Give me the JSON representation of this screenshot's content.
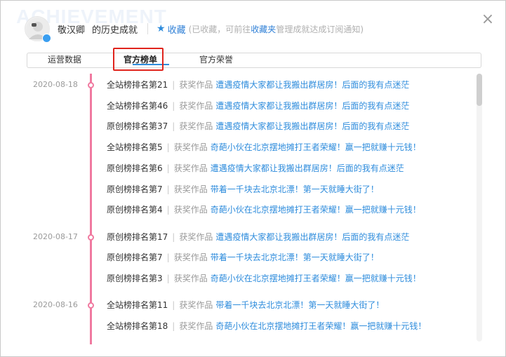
{
  "background_word": "ACHIEVEMENT",
  "header": {
    "username": "敬汉卿",
    "subtitle": "的历史成就",
    "favorite_label": "收藏",
    "favorite_note_prefix": "(已收藏，可前往",
    "favorite_note_link": "收藏夹",
    "favorite_note_suffix": "管理成就达成订阅通知)"
  },
  "close_symbol": "×",
  "tabs": [
    {
      "label": "运营数据",
      "active": false
    },
    {
      "label": "官方榜单",
      "active": true
    },
    {
      "label": "官方荣誉",
      "active": false
    }
  ],
  "award_label": "获奖作品",
  "groups": [
    {
      "date": "2020-08-18",
      "rows": [
        {
          "rank": "全站榜排名第21",
          "work": "遭遇疫情大家都让我搬出群居房！后面的我有点迷茫"
        },
        {
          "rank": "全站榜排名第46",
          "work": "遭遇疫情大家都让我搬出群居房！后面的我有点迷茫"
        },
        {
          "rank": "原创榜排名第37",
          "work": "遭遇疫情大家都让我搬出群居房！后面的我有点迷茫"
        },
        {
          "rank": "全站榜排名第5",
          "work": "奇葩小伙在北京摆地摊打王者荣耀！赢一把就赚十元钱！"
        },
        {
          "rank": "原创榜排名第6",
          "work": "遭遇疫情大家都让我搬出群居房！后面的我有点迷茫"
        },
        {
          "rank": "原创榜排名第7",
          "work": "带着一千块去北京北漂！第一天就睡大街了！"
        },
        {
          "rank": "原创榜排名第4",
          "work": "奇葩小伙在北京摆地摊打王者荣耀！赢一把就赚十元钱！"
        }
      ]
    },
    {
      "date": "2020-08-17",
      "rows": [
        {
          "rank": "原创榜排名第17",
          "work": "遭遇疫情大家都让我搬出群居房！后面的我有点迷茫"
        },
        {
          "rank": "原创榜排名第7",
          "work": "带着一千块去北京北漂！第一天就睡大街了！"
        },
        {
          "rank": "原创榜排名第3",
          "work": "奇葩小伙在北京摆地摊打王者荣耀！赢一把就赚十元钱！"
        }
      ]
    },
    {
      "date": "2020-08-16",
      "rows": [
        {
          "rank": "全站榜排名第11",
          "work": "带着一千块去北京北漂！第一天就睡大街了！"
        },
        {
          "rank": "全站榜排名第18",
          "work": "奇葩小伙在北京摆地摊打王者荣耀！赢一把就赚十元钱！"
        }
      ]
    }
  ],
  "colors": {
    "accent": "#2e8cdc",
    "timeline": "#f07aa0",
    "highlight_box": "#e0241d"
  }
}
